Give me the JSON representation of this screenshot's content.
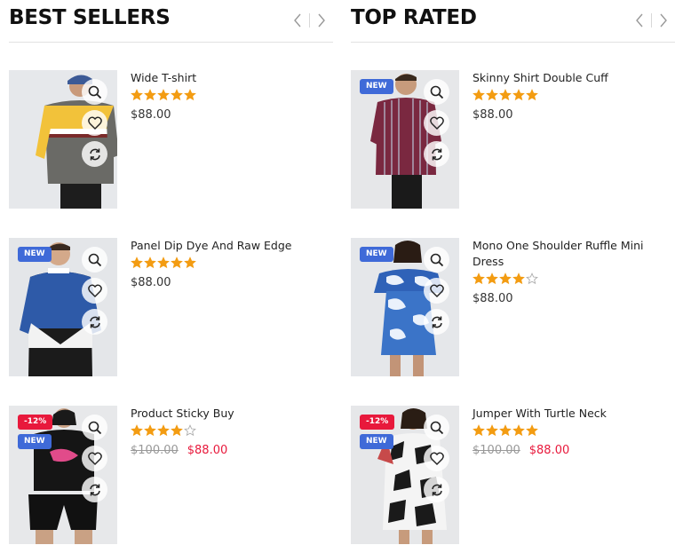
{
  "colors": {
    "accent_new": "#3f6ad8",
    "accent_sale": "#e8193c",
    "star": "#f39c12"
  },
  "best_sellers": {
    "title": "BEST SELLERS",
    "products": [
      {
        "name": "Wide T-shirt",
        "rating": 5,
        "price": "$88.00",
        "old_price": "",
        "badges": []
      },
      {
        "name": "Panel Dip Dye And Raw Edge",
        "rating": 5,
        "price": "$88.00",
        "old_price": "",
        "badges": [
          "NEW"
        ]
      },
      {
        "name": "Product Sticky Buy",
        "rating": 4,
        "price": "$88.00",
        "old_price": "$100.00",
        "badges": [
          "-12%",
          "NEW"
        ]
      }
    ]
  },
  "top_rated": {
    "title": "TOP RATED",
    "products": [
      {
        "name": "Skinny Shirt Double Cuff",
        "rating": 5,
        "price": "$88.00",
        "old_price": "",
        "badges": [
          "NEW"
        ]
      },
      {
        "name": "Mono One Shoulder Ruffle Mini Dress",
        "rating": 4,
        "price": "$88.00",
        "old_price": "",
        "badges": [
          "NEW"
        ]
      },
      {
        "name": "Jumper With Turtle Neck",
        "rating": 5,
        "price": "$88.00",
        "old_price": "$100.00",
        "badges": [
          "-12%",
          "NEW"
        ]
      }
    ]
  },
  "icons": {
    "nav": [
      "chevron-left-icon",
      "chevron-right-icon"
    ],
    "actions": [
      "search-icon",
      "heart-icon",
      "refresh-icon"
    ]
  }
}
